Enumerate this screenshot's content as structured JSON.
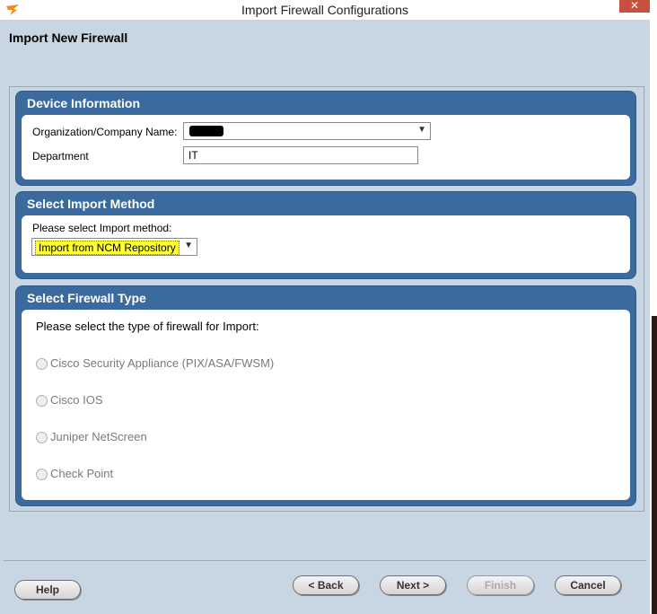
{
  "window": {
    "title": "Import Firewall Configurations",
    "close_label": "✕"
  },
  "header": {
    "title": "Import New Firewall"
  },
  "device_info": {
    "title": "Device Information",
    "org_label": "Organization/Company Name:",
    "dept_label": "Department",
    "dept_value": "IT"
  },
  "import_method": {
    "title": "Select Import Method",
    "prompt": "Please select Import method:",
    "selected": "Import from NCM Repository"
  },
  "firewall_type": {
    "title": "Select Firewall Type",
    "prompt": "Please select the type of firewall for Import:",
    "options": [
      "Cisco Security Appliance (PIX/ASA/FWSM)",
      "Cisco IOS",
      "Juniper NetScreen",
      "Check Point"
    ]
  },
  "footer": {
    "help": "Help",
    "back": "< Back",
    "next": "Next >",
    "finish": "Finish",
    "cancel": "Cancel"
  },
  "colors": {
    "panel_header": "#3b6b9e",
    "window_bg": "#c8d6e3",
    "highlight": "#ffff33"
  }
}
